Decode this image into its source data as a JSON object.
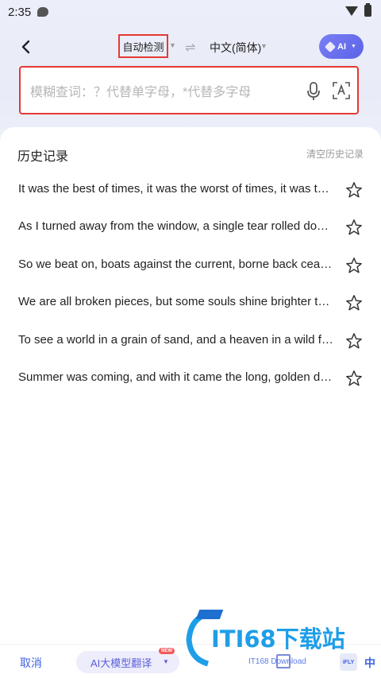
{
  "status_bar": {
    "time": "2:35"
  },
  "header": {
    "source_language": "自动检测",
    "target_language": "中文(简体)",
    "ai_button_label": "AI"
  },
  "search": {
    "placeholder": "模糊查词：？代替单字母，*代替多字母"
  },
  "history": {
    "title": "历史记录",
    "clear_label": "清空历史记录",
    "items": [
      "It was the best of times, it was the worst of times, it was the age of wisdom",
      "As I turned away from the window, a single tear rolled down my cheek",
      "So we beat on, boats against the current, borne back ceaselessly into the past",
      "We are all broken pieces, but some souls shine brighter through the cracks",
      "To see a world in a grain of sand, and a heaven in a wild flower",
      "Summer was coming, and with it came the long, golden days of childhood"
    ]
  },
  "bottom_bar": {
    "cancel_label": "取消",
    "ai_model_label": "AI大模型翻译",
    "new_badge": "NEW",
    "caption": "IT168 Download",
    "logo_text": "iFLY",
    "zh_label": "中"
  },
  "watermark": {
    "text": "ITI68下载站"
  },
  "colors": {
    "accent": "#3f62e6",
    "highlight_border": "#e53935",
    "ai_gradient_start": "#7a7ff5",
    "ai_gradient_end": "#5b63e6"
  },
  "icons": [
    "back-icon",
    "swap-icon",
    "mic-icon",
    "ocr-icon",
    "star-icon"
  ]
}
